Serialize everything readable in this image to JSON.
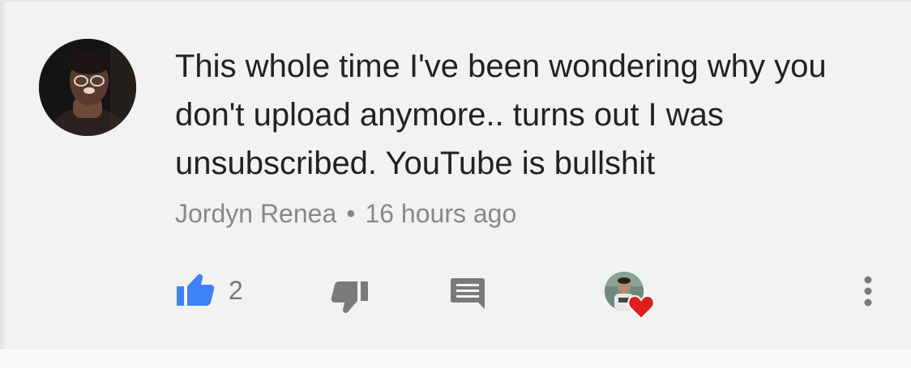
{
  "comment": {
    "author": "Jordyn Renea",
    "time": "16 hours ago",
    "separator": "•",
    "text": "This whole time I've been wondering why you don't upload anymore.. turns out I was unsubscribed. YouTube is bullshit"
  },
  "actions": {
    "like_count": "2",
    "like_icon": "thumbs-up-icon",
    "dislike_icon": "thumbs-down-icon",
    "reply_icon": "comment-icon",
    "more_icon": "more-vert-icon"
  },
  "colors": {
    "like_active": "#3e82f7",
    "icon_gray": "#7a7a7a",
    "heart": "#e01e1e"
  }
}
